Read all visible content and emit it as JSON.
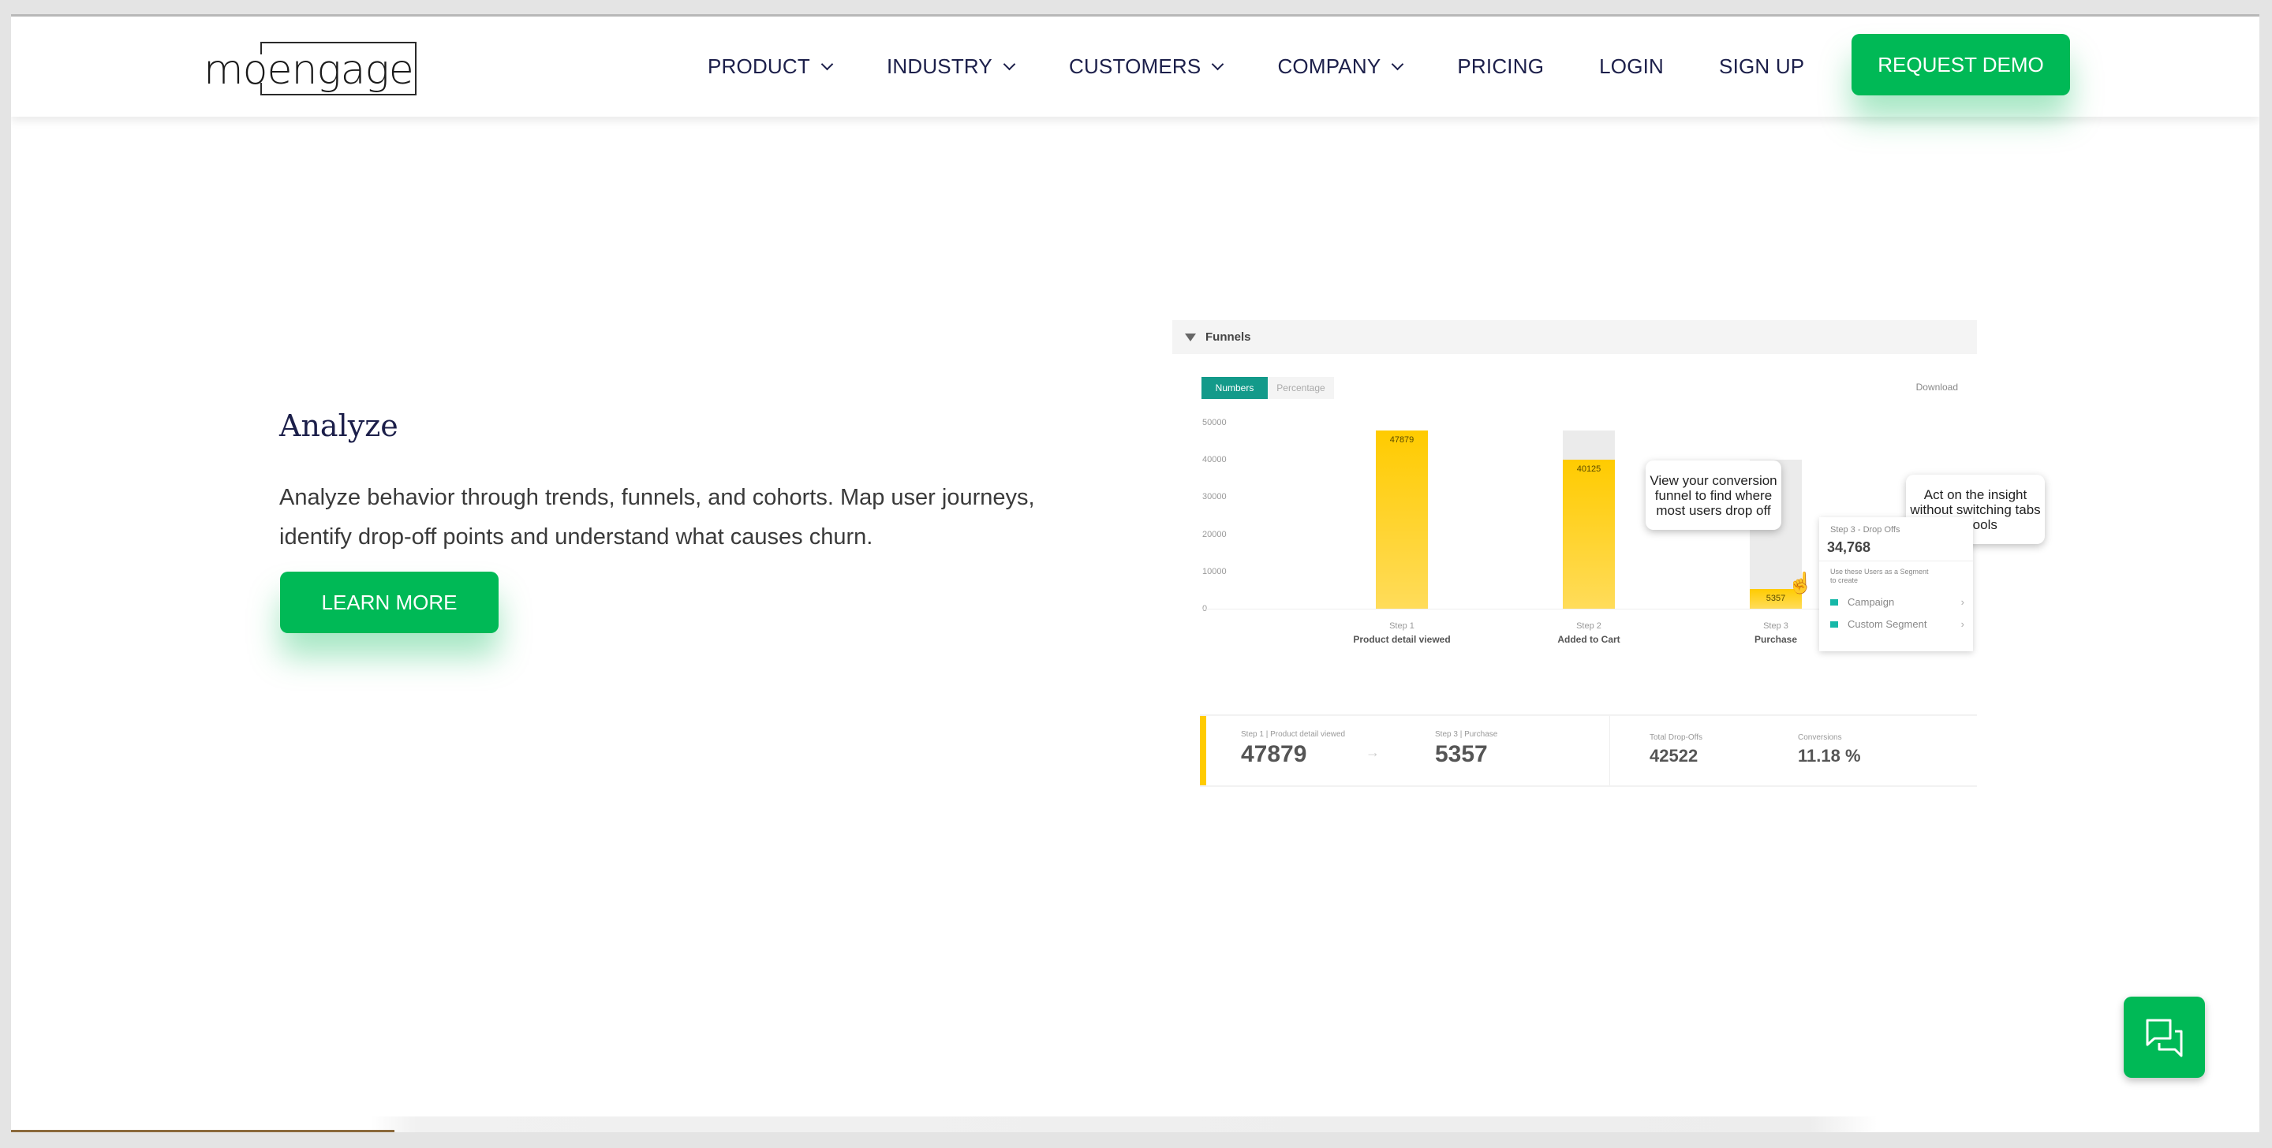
{
  "header": {
    "logo_text_left": "mo",
    "logo_text_right": "engage",
    "nav": [
      {
        "label": "PRODUCT",
        "dropdown": true
      },
      {
        "label": "INDUSTRY",
        "dropdown": true
      },
      {
        "label": "CUSTOMERS",
        "dropdown": true
      },
      {
        "label": "COMPANY",
        "dropdown": true
      },
      {
        "label": "PRICING",
        "dropdown": false
      },
      {
        "label": "LOGIN",
        "dropdown": false
      },
      {
        "label": "SIGN UP",
        "dropdown": false
      }
    ],
    "cta_label": "REQUEST DEMO"
  },
  "section": {
    "title": "Analyze",
    "description_line1": "Analyze behavior through trends, funnels, and cohorts. Map user journeys,",
    "description_line2": "identify drop-off points and understand what causes churn.",
    "cta_label": "LEARN MORE"
  },
  "funnel": {
    "panel_title": "Funnels",
    "toggle": [
      "Numbers",
      "Percentage"
    ],
    "toggle_selected": "Numbers",
    "download_label": "Download",
    "callout_left": "View your conversion funnel to find where most users drop off",
    "callout_right": "Act on the insight without switching tabs or tools",
    "popup": {
      "title": "Step 3 - Drop Offs",
      "value": "34,768",
      "hint": "Use these Users as a Segment to create",
      "options": [
        "Campaign",
        "Custom Segment"
      ]
    },
    "summary": {
      "from_label": "Step 1 | Product detail viewed",
      "from_value": "47879",
      "to_label": "Step 3 | Purchase",
      "to_value": "5357",
      "dropoffs_label": "Total Drop-Offs",
      "dropoffs_value": "42522",
      "conversion_label": "Conversions",
      "conversion_value": "11.18 %"
    }
  },
  "chart_data": {
    "type": "bar",
    "title": "Funnels",
    "categories": [
      "Product detail viewed",
      "Added to Cart",
      "Purchase"
    ],
    "step_labels": [
      "Step 1",
      "Step 2",
      "Step 3"
    ],
    "values": [
      47879,
      40125,
      5357
    ],
    "previous_step_values": [
      47879,
      47879,
      40125
    ],
    "value_labels": [
      "47879",
      "40125",
      "5357"
    ],
    "yticks": [
      "50000",
      "40000",
      "30000",
      "20000",
      "10000",
      "0"
    ],
    "ylim": [
      0,
      50000
    ],
    "xlabel": "",
    "ylabel": "",
    "colors": {
      "bar": "#ffcb00",
      "dropoff": "#ebebeb"
    }
  },
  "colors": {
    "brand_green": "#00b956",
    "nav_text": "#1c1f4a",
    "toggle_active": "#139a8a"
  }
}
